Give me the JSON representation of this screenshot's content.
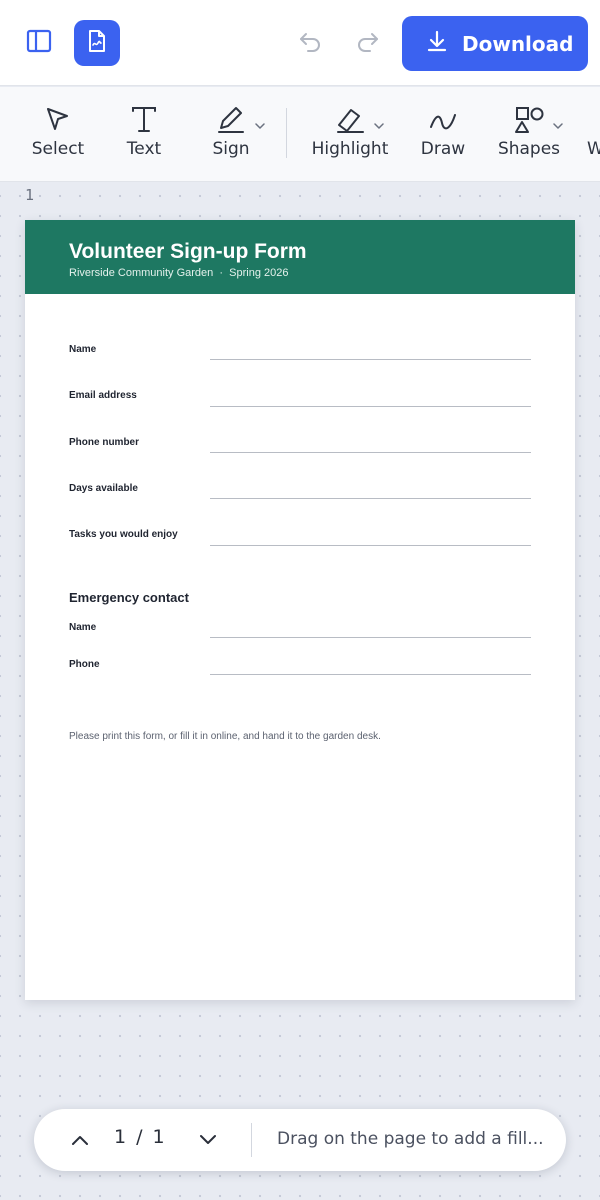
{
  "topbar": {
    "download_label": "Download"
  },
  "toolbar": {
    "tools": [
      {
        "label": "Select",
        "icon": "cursor-arrow-icon"
      },
      {
        "label": "Text",
        "icon": "text-T-icon"
      },
      {
        "label": "Sign",
        "icon": "pen-icon"
      },
      {
        "label": "Highlight",
        "icon": "highlighter-icon"
      },
      {
        "label": "Draw",
        "icon": "squiggle-icon"
      },
      {
        "label": "Shapes",
        "icon": "shapes-icon"
      },
      {
        "label": "W",
        "icon": "none"
      }
    ]
  },
  "canvas": {
    "page_number": "1"
  },
  "form": {
    "title": "Volunteer Sign-up Form",
    "subtitle": "Riverside Community Garden  ·  Spring 2026",
    "fields": [
      {
        "label": "Name"
      },
      {
        "label": "Email address"
      },
      {
        "label": "Phone number"
      },
      {
        "label": "Days available"
      },
      {
        "label": "Tasks you would enjoy"
      }
    ],
    "emergency": {
      "title": "Emergency contact",
      "fields": [
        {
          "label": "Name"
        },
        {
          "label": "Phone"
        }
      ]
    },
    "footnote": "Please print this form, or fill it in online, and hand it to the garden desk."
  },
  "pager": {
    "current": "1",
    "separator": "/",
    "total": "1",
    "hint": "Drag on the page to add a fill..."
  },
  "colors": {
    "accent": "#3b62f0",
    "header_green": "#1e7862"
  }
}
